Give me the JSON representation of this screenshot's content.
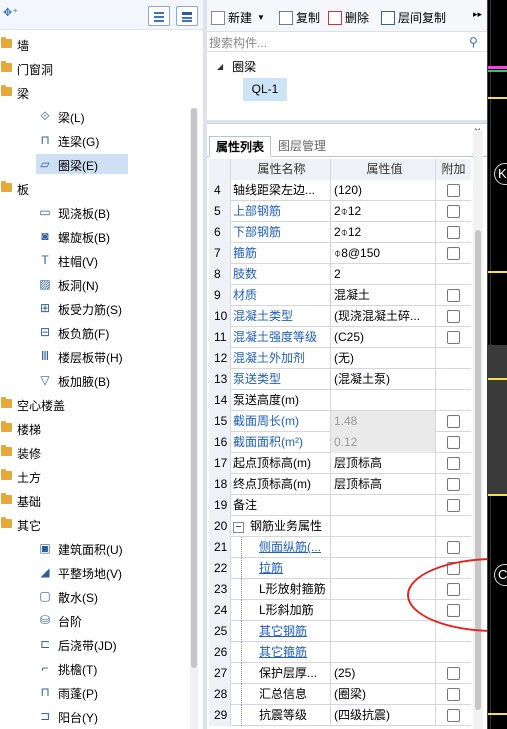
{
  "tree": {
    "categories": [
      {
        "label": "墙"
      },
      {
        "label": "门窗洞"
      },
      {
        "label": "梁",
        "children": [
          {
            "label": "梁(L)",
            "icon": "beam-icon"
          },
          {
            "label": "连梁(G)",
            "icon": "coupling-beam-icon"
          },
          {
            "label": "圈梁(E)",
            "icon": "ring-beam-icon",
            "selected": true
          }
        ]
      },
      {
        "label": "板",
        "children": [
          {
            "label": "现浇板(B)",
            "icon": "cast-slab-icon"
          },
          {
            "label": "螺旋板(B)",
            "icon": "spiral-slab-icon"
          },
          {
            "label": "柱帽(V)",
            "icon": "column-cap-icon"
          },
          {
            "label": "板洞(N)",
            "icon": "slab-hole-icon"
          },
          {
            "label": "板受力筋(S)",
            "icon": "slab-rebar-icon"
          },
          {
            "label": "板负筋(F)",
            "icon": "negative-rebar-icon"
          },
          {
            "label": "楼层板带(H)",
            "icon": "slab-strip-icon"
          },
          {
            "label": "板加腋(B)",
            "icon": "slab-haunch-icon"
          }
        ]
      },
      {
        "label": "空心楼盖"
      },
      {
        "label": "楼梯"
      },
      {
        "label": "装修"
      },
      {
        "label": "土方"
      },
      {
        "label": "基础"
      },
      {
        "label": "其它",
        "children": [
          {
            "label": "建筑面积(U)",
            "icon": "building-area-icon"
          },
          {
            "label": "平整场地(V)",
            "icon": "site-leveling-icon"
          },
          {
            "label": "散水(S)",
            "icon": "apron-icon"
          },
          {
            "label": "台阶",
            "icon": "steps-icon"
          },
          {
            "label": "后浇带(JD)",
            "icon": "post-cast-strip-icon"
          },
          {
            "label": "挑檐(T)",
            "icon": "eave-icon"
          },
          {
            "label": "雨蓬(P)",
            "icon": "canopy-icon"
          },
          {
            "label": "阳台(Y)",
            "icon": "balcony-icon"
          }
        ]
      }
    ]
  },
  "toolbar": {
    "new_label": "新建",
    "copy_label": "复制",
    "delete_label": "删除",
    "floor_copy_label": "层间复制",
    "more": "▸▸"
  },
  "search": {
    "placeholder": "搜索构件..."
  },
  "component_tree": {
    "root": "圈梁",
    "item": "QL-1"
  },
  "props": {
    "tab_active": "属性列表",
    "tab_inactive": "图层管理",
    "headers": {
      "name": "属性名称",
      "value": "属性值",
      "extra": "附加"
    },
    "rows": [
      {
        "idx": "4",
        "name": "轴线距梁左边...",
        "value": "(120)",
        "check": true
      },
      {
        "idx": "5",
        "name": "上部钢筋",
        "value": "2⌽12",
        "blue": true,
        "check": true
      },
      {
        "idx": "6",
        "name": "下部钢筋",
        "value": "2⌽12",
        "blue": true,
        "check": true
      },
      {
        "idx": "7",
        "name": "箍筋",
        "value": "⌽8@150",
        "blue": true,
        "check": true
      },
      {
        "idx": "8",
        "name": "肢数",
        "value": "2",
        "blue": true,
        "check": false
      },
      {
        "idx": "9",
        "name": "材质",
        "value": "混凝土",
        "blue": true,
        "check": true
      },
      {
        "idx": "10",
        "name": "混凝土类型",
        "value": "(现浇混凝土碎...",
        "blue": true,
        "check": true
      },
      {
        "idx": "11",
        "name": "混凝土强度等级",
        "value": "(C25)",
        "blue": true,
        "check": true
      },
      {
        "idx": "12",
        "name": "混凝土外加剂",
        "value": "(无)",
        "blue": true,
        "check": false
      },
      {
        "idx": "13",
        "name": "泵送类型",
        "value": "(混凝土泵)",
        "blue": true,
        "check": false
      },
      {
        "idx": "14",
        "name": "泵送高度(m)",
        "value": "",
        "check": false
      },
      {
        "idx": "15",
        "name": "截面周长(m)",
        "value": "1.48",
        "blue": true,
        "shade": true,
        "check": true
      },
      {
        "idx": "16",
        "name": "截面面积(m²)",
        "value": "0.12",
        "blue": true,
        "shade": true,
        "check": true
      },
      {
        "idx": "17",
        "name": "起点顶标高(m)",
        "value": "层顶标高",
        "check": true
      },
      {
        "idx": "18",
        "name": "终点顶标高(m)",
        "value": "层顶标高",
        "check": true
      },
      {
        "idx": "19",
        "name": "备注",
        "value": "",
        "check": true
      },
      {
        "idx": "20",
        "name": "钢筋业务属性",
        "value": "",
        "group": true,
        "check": false
      },
      {
        "idx": "21",
        "name": "侧面纵筋(...",
        "value": "",
        "blue": true,
        "sub": true,
        "check": true
      },
      {
        "idx": "22",
        "name": "拉筋",
        "value": "",
        "blue": true,
        "sub": true,
        "check": true
      },
      {
        "idx": "23",
        "name": "L形放射箍筋",
        "value": "",
        "sub": true,
        "check": true
      },
      {
        "idx": "24",
        "name": "L形斜加筋",
        "value": "",
        "sub": true,
        "check": true
      },
      {
        "idx": "25",
        "name": "其它钢筋",
        "value": "",
        "blue": true,
        "sub": true,
        "check": false
      },
      {
        "idx": "26",
        "name": "其它箍筋",
        "value": "",
        "blue": true,
        "sub": true,
        "check": false
      },
      {
        "idx": "27",
        "name": "保护层厚...",
        "value": "(25)",
        "sub": true,
        "check": true
      },
      {
        "idx": "28",
        "name": "汇总信息",
        "value": "(圈梁)",
        "sub": true,
        "check": true
      },
      {
        "idx": "29",
        "name": "抗震等级",
        "value": "(四级抗震)",
        "sub": true,
        "check": true
      }
    ]
  },
  "canvas": {
    "label_top": "K",
    "label_bottom": "C",
    "colors": {
      "bg": "#000000",
      "beam": "#f5e04a",
      "magenta": "#ff3df0",
      "green": "#34c759"
    }
  },
  "annotation_color": "#e8201c"
}
